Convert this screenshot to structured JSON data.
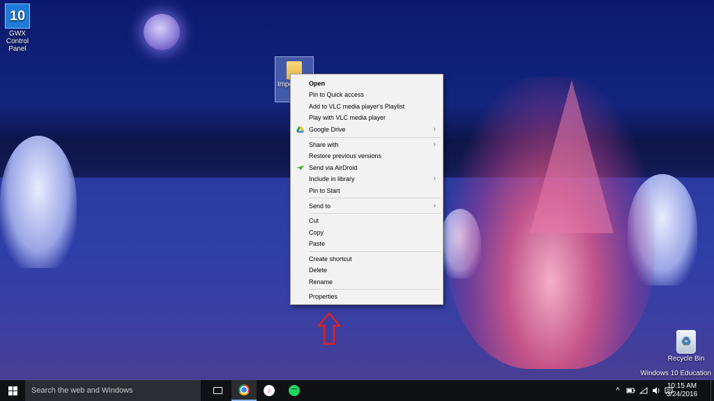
{
  "desktop": {
    "icons": [
      {
        "label": "GWX Control Panel",
        "glyph": "10"
      },
      {
        "label": "Impo Docu",
        "glyph": ""
      },
      {
        "label": "Recycle Bin",
        "glyph": "♻"
      }
    ],
    "watermark": "Windows 10 Education"
  },
  "context_menu": {
    "items": [
      {
        "label": "Open",
        "bold": true,
        "icon": ""
      },
      {
        "label": "Pin to Quick access",
        "icon": ""
      },
      {
        "label": "Add to VLC media player's Playlist",
        "icon": ""
      },
      {
        "label": "Play with VLC media player",
        "icon": ""
      },
      {
        "label": "Google Drive",
        "icon": "google-drive-icon",
        "submenu": true
      },
      {
        "label": "Share with",
        "icon": "",
        "submenu": true
      },
      {
        "label": "Restore previous versions",
        "icon": ""
      },
      {
        "label": "Send via AirDroid",
        "icon": "airdroid-icon"
      },
      {
        "label": "Include in library",
        "icon": "",
        "submenu": true
      },
      {
        "label": "Pin to Start",
        "icon": ""
      },
      {
        "label": "Send to",
        "icon": "",
        "submenu": true
      },
      {
        "label": "Cut",
        "icon": ""
      },
      {
        "label": "Copy",
        "icon": ""
      },
      {
        "label": "Paste",
        "icon": ""
      },
      {
        "label": "Create shortcut",
        "icon": ""
      },
      {
        "label": "Delete",
        "icon": ""
      },
      {
        "label": "Rename",
        "icon": ""
      },
      {
        "label": "Properties",
        "icon": ""
      }
    ],
    "submenu_arrow": "›"
  },
  "taskbar": {
    "search_placeholder": "Search the web and Windows",
    "apps": [
      "task-view-icon",
      "chrome-icon",
      "itunes-icon",
      "spotify-icon"
    ],
    "tray": {
      "chevron": "^",
      "icons": [
        "battery-icon",
        "wifi-icon",
        "volume-icon",
        "action-center-icon"
      ],
      "time": "10:15 AM",
      "date": "3/24/2016"
    }
  },
  "colors": {
    "annotation_arrow": "#e02020",
    "taskbar_bg": "#101114",
    "menu_bg": "#f2f2f2"
  }
}
